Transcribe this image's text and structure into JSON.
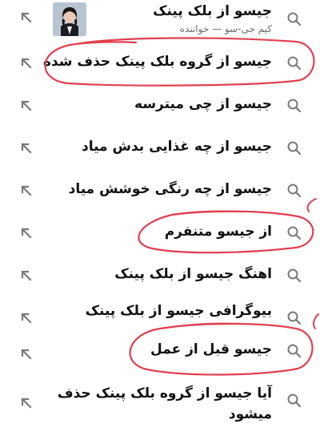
{
  "suggestions": [
    {
      "text": "جیسو از بلک پینک",
      "subtitle": "کیم جی-سو — خواننده",
      "has_thumbnail": true,
      "circled": false
    },
    {
      "text": "جیسو از گروه بلک پینک حذف شده",
      "circled": true
    },
    {
      "text": "جیسو از چی میترسه",
      "circled": false
    },
    {
      "text": "جیسو از چه غذایی بدش میاد",
      "circled": false
    },
    {
      "text": "جیسو از چه رنگی خوشش میاد",
      "circled": false
    },
    {
      "text": "از جیسو متنفرم",
      "circled": true
    },
    {
      "text": "اهنگ جیسو از بلک پینک",
      "circled": false
    },
    {
      "text": "بیوگرافی جیسو از بلک پینک",
      "circled": false
    },
    {
      "text": "جیسو قبل از عمل",
      "circled": true
    },
    {
      "text_line1": "آیا جیسو از گروه بلک پینک حذف",
      "text_line2": "میشود",
      "circled": false
    }
  ],
  "icons": {
    "search": "search-icon",
    "arrow": "arrow-up-left-icon"
  },
  "colors": {
    "text": "#111111",
    "subtext": "#6b6b6b",
    "icon": "#7a7a7a",
    "annotation": "#e04050"
  }
}
